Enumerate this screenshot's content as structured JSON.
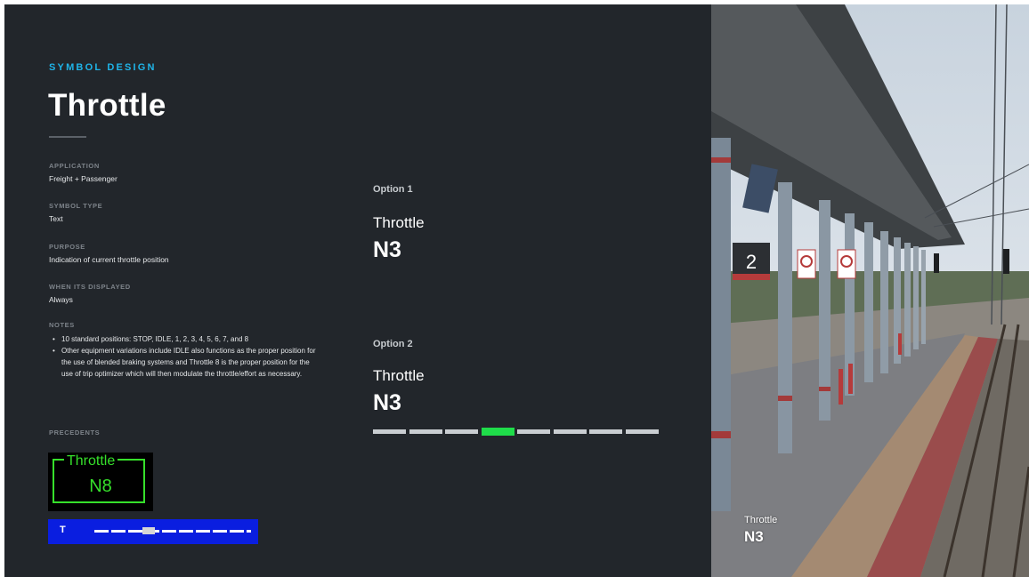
{
  "header": {
    "eyebrow": "SYMBOL DESIGN",
    "title": "Throttle"
  },
  "details": [
    {
      "label": "APPLICATION",
      "value": "Freight + Passenger"
    },
    {
      "label": "SYMBOL TYPE",
      "value": "Text"
    },
    {
      "label": "PURPOSE",
      "value": "Indication of current throttle position"
    },
    {
      "label": "WHEN ITS DISPLAYED",
      "value": "Always"
    }
  ],
  "notes": {
    "label": "NOTES",
    "items": [
      "10 standard positions: STOP, IDLE, 1, 2, 3, 4, 5, 6, 7, and 8",
      "Other equipment variations include IDLE also functions as the proper position for the use of blended braking systems and Throttle 8 is the proper position for the use of trip optimizer which will then modulate the throttle/effort as necessary."
    ]
  },
  "precedents": {
    "label": "PRECEDENTS",
    "green_display": {
      "title": "Throttle",
      "value": "N8",
      "color": "#36e02b"
    },
    "blue_bar": {
      "glyph": "T",
      "background": "#0a1ee0"
    }
  },
  "options": [
    {
      "label": "Option 1",
      "title": "Throttle",
      "value": "N3"
    },
    {
      "label": "Option 2",
      "title": "Throttle",
      "value": "N3",
      "segments": 8,
      "active_index": 3,
      "active_color": "#1fdd4a"
    }
  ],
  "photo": {
    "platform_sign": "2",
    "overlay": {
      "title": "Throttle",
      "value": "N3"
    }
  },
  "colors": {
    "background": "#22262b",
    "accent": "#1fb4e8"
  }
}
